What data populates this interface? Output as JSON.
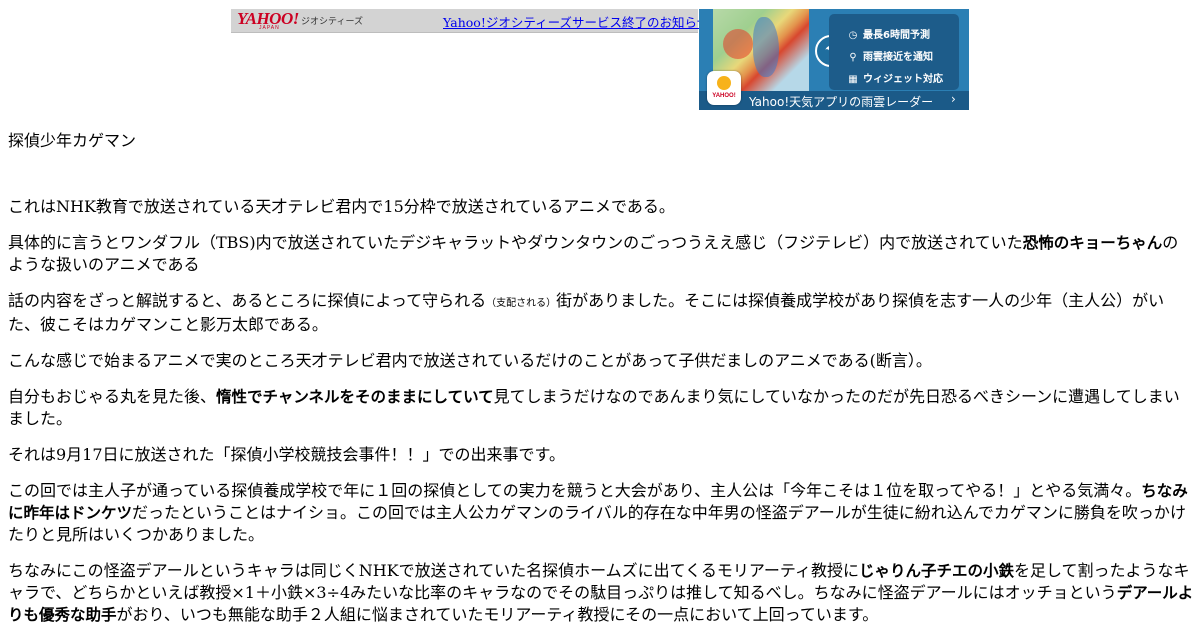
{
  "topbar": {
    "logo": "YAHOO!",
    "logo_sub": "JAPAN",
    "service_label": "ジオシティーズ",
    "notice_link": "Yahoo!ジオシティーズサービス終了のお知らせ"
  },
  "banner": {
    "features": [
      {
        "icon": "clock-icon",
        "label": "最長6時間予測"
      },
      {
        "icon": "location-pin-icon",
        "label": "雨雲接近を通知"
      },
      {
        "icon": "widget-grid-icon",
        "label": "ウィジェット対応"
      }
    ],
    "app_icon_label": "YAHOO!",
    "caption": "Yahoo!天気アプリの雨雲レーダー",
    "arrow": "›"
  },
  "article": {
    "title": "探偵少年カゲマン",
    "p1": "これはNHK教育で放送されている天才テレビ君内で15分枠で放送されているアニメである。",
    "p2_a": "具体的に言うとワンダフル（TBS)内で放送されていたデジキャラットやダウンタウンのごっつうええ感じ（フジテレビ）内で放送されていた",
    "p2_b": "恐怖のキョーちゃん",
    "p2_c": "のような扱いのアニメである",
    "p3_a": "話の内容をざっと解説すると、あるところに探偵によって守られる",
    "p3_small": "（支配される）",
    "p3_b": "街がありました。そこには探偵養成学校があり探偵を志す一人の少年（主人公）がいた、彼こそはカゲマンこと影万太郎である。",
    "p4": "こんな感じで始まるアニメで実のところ天才テレビ君内で放送されているだけのことがあって子供だましのアニメである(断言）。",
    "p5_a": "自分もおじゃる丸を見た後、",
    "p5_b": "惰性でチャンネルをそのままにしていて",
    "p5_c": "見てしまうだけなのであんまり気にしていなかったのだが先日恐るべきシーンに遭遇してしまいました。",
    "p6": "それは9月17日に放送された「探偵小学校競技会事件！！」での出来事です。",
    "p7_a": "この回では主人子が通っている探偵養成学校で年に１回の探偵としての実力を競うと大会があり、主人公は「今年こそは１位を取ってやる！」とやる気満々。",
    "p7_b": "ちなみに昨年はドンケツ",
    "p7_c": "だったということはナイショ。この回では主人公カゲマンのライバル的存在な中年男の怪盗デアールが生徒に紛れ込んでカゲマンに勝負を吹っかけたりと見所はいくつかありました。",
    "p8_a": "ちなみにこの怪盗デアールというキャラは同じくNHKで放送されていた名探偵ホームズに出てくるモリアーティ教授に",
    "p8_b": "じゃりん子チエの小鉄",
    "p8_c": "を足して割ったようなキャラで、どちらかといえば教授×1＋小鉄×3÷4みたいな比率のキャラなのでその駄目っぷりは推して知るべし。ちなみに怪盗デアールにはオッチョという",
    "p8_d": "デアールよりも優秀な助手",
    "p8_e": "がおり、いつも無能な助手２人組に悩まされていたモリアーティ教授にその一点において上回っています。"
  }
}
